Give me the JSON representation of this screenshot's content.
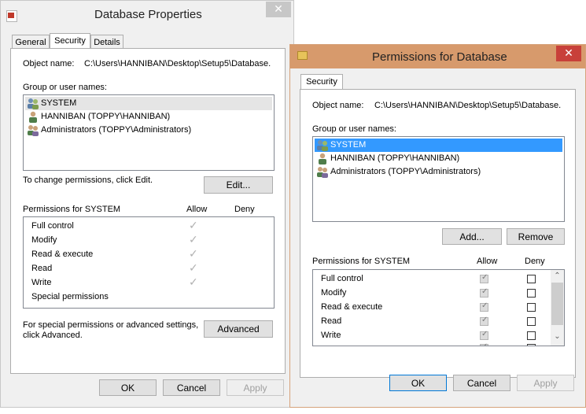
{
  "back_window": {
    "title": "Database Properties",
    "close_glyph": "✕",
    "tabs": [
      {
        "label": "General",
        "active": false
      },
      {
        "label": "Security",
        "active": true
      },
      {
        "label": "Details",
        "active": false
      }
    ],
    "object_name_label": "Object name:",
    "object_name_value": "C:\\Users\\HANNIBAN\\Desktop\\Setup5\\Database.",
    "group_label": "Group or user names:",
    "users": [
      {
        "name": "SYSTEM",
        "icon": "group-users-icon",
        "selected": true
      },
      {
        "name": "HANNIBAN (TOPPY\\HANNIBAN)",
        "icon": "user-icon",
        "selected": false
      },
      {
        "name": "Administrators (TOPPY\\Administrators)",
        "icon": "group-users-icon",
        "selected": false
      }
    ],
    "change_hint": "To change permissions, click Edit.",
    "edit_label": "Edit...",
    "permissions_for": "Permissions for SYSTEM",
    "allow_header": "Allow",
    "deny_header": "Deny",
    "permissions": [
      {
        "name": "Full control",
        "allow": true,
        "deny": false
      },
      {
        "name": "Modify",
        "allow": true,
        "deny": false
      },
      {
        "name": "Read & execute",
        "allow": true,
        "deny": false
      },
      {
        "name": "Read",
        "allow": true,
        "deny": false
      },
      {
        "name": "Write",
        "allow": true,
        "deny": false
      },
      {
        "name": "Special permissions",
        "allow": false,
        "deny": false
      }
    ],
    "check_glyph": "✓",
    "advanced_hint_1": "For special permissions or advanced settings,",
    "advanced_hint_2": "click Advanced.",
    "advanced_label": "Advanced",
    "ok_label": "OK",
    "cancel_label": "Cancel",
    "apply_label": "Apply"
  },
  "front_window": {
    "title": "Permissions for Database",
    "close_glyph": "✕",
    "tab_label": "Security",
    "object_name_label": "Object name:",
    "object_name_value": "C:\\Users\\HANNIBAN\\Desktop\\Setup5\\Database.",
    "group_label": "Group or user names:",
    "users": [
      {
        "name": "SYSTEM",
        "icon": "group-users-icon",
        "selected": true
      },
      {
        "name": "HANNIBAN (TOPPY\\HANNIBAN)",
        "icon": "user-icon",
        "selected": false
      },
      {
        "name": "Administrators (TOPPY\\Administrators)",
        "icon": "group-users-icon",
        "selected": false
      }
    ],
    "add_label": "Add...",
    "remove_label": "Remove",
    "permissions_for": "Permissions for SYSTEM",
    "allow_header": "Allow",
    "deny_header": "Deny",
    "permissions": [
      {
        "name": "Full control",
        "allow": true,
        "deny": false
      },
      {
        "name": "Modify",
        "allow": true,
        "deny": false
      },
      {
        "name": "Read & execute",
        "allow": true,
        "deny": false
      },
      {
        "name": "Read",
        "allow": true,
        "deny": false
      },
      {
        "name": "Write",
        "allow": true,
        "deny": false
      }
    ],
    "scroll_up_glyph": "⌃",
    "scroll_down_glyph": "⌄",
    "ok_label": "OK",
    "cancel_label": "Cancel",
    "apply_label": "Apply"
  },
  "colors": {
    "selection": "#3399ff",
    "front_titlebar": "#d79a6c",
    "close_red": "#c8403a"
  }
}
